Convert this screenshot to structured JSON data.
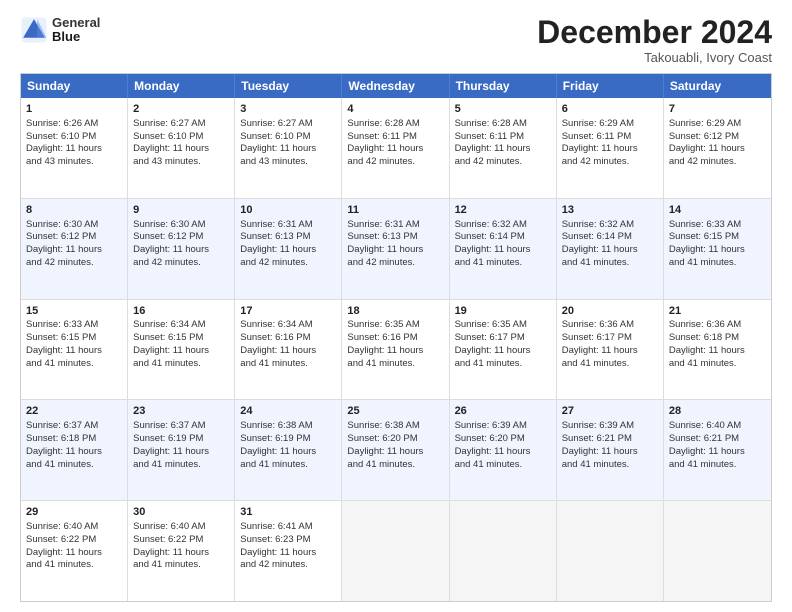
{
  "header": {
    "logo_line1": "General",
    "logo_line2": "Blue",
    "month": "December 2024",
    "location": "Takouabli, Ivory Coast"
  },
  "days_of_week": [
    "Sunday",
    "Monday",
    "Tuesday",
    "Wednesday",
    "Thursday",
    "Friday",
    "Saturday"
  ],
  "weeks": [
    [
      {
        "day": "1",
        "lines": [
          "Sunrise: 6:26 AM",
          "Sunset: 6:10 PM",
          "Daylight: 11 hours",
          "and 43 minutes."
        ]
      },
      {
        "day": "2",
        "lines": [
          "Sunrise: 6:27 AM",
          "Sunset: 6:10 PM",
          "Daylight: 11 hours",
          "and 43 minutes."
        ]
      },
      {
        "day": "3",
        "lines": [
          "Sunrise: 6:27 AM",
          "Sunset: 6:10 PM",
          "Daylight: 11 hours",
          "and 43 minutes."
        ]
      },
      {
        "day": "4",
        "lines": [
          "Sunrise: 6:28 AM",
          "Sunset: 6:11 PM",
          "Daylight: 11 hours",
          "and 42 minutes."
        ]
      },
      {
        "day": "5",
        "lines": [
          "Sunrise: 6:28 AM",
          "Sunset: 6:11 PM",
          "Daylight: 11 hours",
          "and 42 minutes."
        ]
      },
      {
        "day": "6",
        "lines": [
          "Sunrise: 6:29 AM",
          "Sunset: 6:11 PM",
          "Daylight: 11 hours",
          "and 42 minutes."
        ]
      },
      {
        "day": "7",
        "lines": [
          "Sunrise: 6:29 AM",
          "Sunset: 6:12 PM",
          "Daylight: 11 hours",
          "and 42 minutes."
        ]
      }
    ],
    [
      {
        "day": "8",
        "lines": [
          "Sunrise: 6:30 AM",
          "Sunset: 6:12 PM",
          "Daylight: 11 hours",
          "and 42 minutes."
        ]
      },
      {
        "day": "9",
        "lines": [
          "Sunrise: 6:30 AM",
          "Sunset: 6:12 PM",
          "Daylight: 11 hours",
          "and 42 minutes."
        ]
      },
      {
        "day": "10",
        "lines": [
          "Sunrise: 6:31 AM",
          "Sunset: 6:13 PM",
          "Daylight: 11 hours",
          "and 42 minutes."
        ]
      },
      {
        "day": "11",
        "lines": [
          "Sunrise: 6:31 AM",
          "Sunset: 6:13 PM",
          "Daylight: 11 hours",
          "and 42 minutes."
        ]
      },
      {
        "day": "12",
        "lines": [
          "Sunrise: 6:32 AM",
          "Sunset: 6:14 PM",
          "Daylight: 11 hours",
          "and 41 minutes."
        ]
      },
      {
        "day": "13",
        "lines": [
          "Sunrise: 6:32 AM",
          "Sunset: 6:14 PM",
          "Daylight: 11 hours",
          "and 41 minutes."
        ]
      },
      {
        "day": "14",
        "lines": [
          "Sunrise: 6:33 AM",
          "Sunset: 6:15 PM",
          "Daylight: 11 hours",
          "and 41 minutes."
        ]
      }
    ],
    [
      {
        "day": "15",
        "lines": [
          "Sunrise: 6:33 AM",
          "Sunset: 6:15 PM",
          "Daylight: 11 hours",
          "and 41 minutes."
        ]
      },
      {
        "day": "16",
        "lines": [
          "Sunrise: 6:34 AM",
          "Sunset: 6:15 PM",
          "Daylight: 11 hours",
          "and 41 minutes."
        ]
      },
      {
        "day": "17",
        "lines": [
          "Sunrise: 6:34 AM",
          "Sunset: 6:16 PM",
          "Daylight: 11 hours",
          "and 41 minutes."
        ]
      },
      {
        "day": "18",
        "lines": [
          "Sunrise: 6:35 AM",
          "Sunset: 6:16 PM",
          "Daylight: 11 hours",
          "and 41 minutes."
        ]
      },
      {
        "day": "19",
        "lines": [
          "Sunrise: 6:35 AM",
          "Sunset: 6:17 PM",
          "Daylight: 11 hours",
          "and 41 minutes."
        ]
      },
      {
        "day": "20",
        "lines": [
          "Sunrise: 6:36 AM",
          "Sunset: 6:17 PM",
          "Daylight: 11 hours",
          "and 41 minutes."
        ]
      },
      {
        "day": "21",
        "lines": [
          "Sunrise: 6:36 AM",
          "Sunset: 6:18 PM",
          "Daylight: 11 hours",
          "and 41 minutes."
        ]
      }
    ],
    [
      {
        "day": "22",
        "lines": [
          "Sunrise: 6:37 AM",
          "Sunset: 6:18 PM",
          "Daylight: 11 hours",
          "and 41 minutes."
        ]
      },
      {
        "day": "23",
        "lines": [
          "Sunrise: 6:37 AM",
          "Sunset: 6:19 PM",
          "Daylight: 11 hours",
          "and 41 minutes."
        ]
      },
      {
        "day": "24",
        "lines": [
          "Sunrise: 6:38 AM",
          "Sunset: 6:19 PM",
          "Daylight: 11 hours",
          "and 41 minutes."
        ]
      },
      {
        "day": "25",
        "lines": [
          "Sunrise: 6:38 AM",
          "Sunset: 6:20 PM",
          "Daylight: 11 hours",
          "and 41 minutes."
        ]
      },
      {
        "day": "26",
        "lines": [
          "Sunrise: 6:39 AM",
          "Sunset: 6:20 PM",
          "Daylight: 11 hours",
          "and 41 minutes."
        ]
      },
      {
        "day": "27",
        "lines": [
          "Sunrise: 6:39 AM",
          "Sunset: 6:21 PM",
          "Daylight: 11 hours",
          "and 41 minutes."
        ]
      },
      {
        "day": "28",
        "lines": [
          "Sunrise: 6:40 AM",
          "Sunset: 6:21 PM",
          "Daylight: 11 hours",
          "and 41 minutes."
        ]
      }
    ],
    [
      {
        "day": "29",
        "lines": [
          "Sunrise: 6:40 AM",
          "Sunset: 6:22 PM",
          "Daylight: 11 hours",
          "and 41 minutes."
        ]
      },
      {
        "day": "30",
        "lines": [
          "Sunrise: 6:40 AM",
          "Sunset: 6:22 PM",
          "Daylight: 11 hours",
          "and 41 minutes."
        ]
      },
      {
        "day": "31",
        "lines": [
          "Sunrise: 6:41 AM",
          "Sunset: 6:23 PM",
          "Daylight: 11 hours",
          "and 42 minutes."
        ]
      },
      {
        "day": "",
        "lines": []
      },
      {
        "day": "",
        "lines": []
      },
      {
        "day": "",
        "lines": []
      },
      {
        "day": "",
        "lines": []
      }
    ]
  ]
}
